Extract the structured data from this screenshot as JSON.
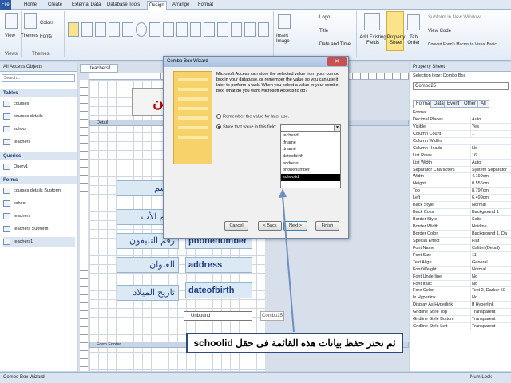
{
  "ribbon_tabs": [
    "File",
    "Home",
    "Create",
    "External Data",
    "Database Tools",
    "Design",
    "Arrange",
    "Format"
  ],
  "ribbon": {
    "view_label": "View",
    "themes_label": "Themes",
    "colors_label": "Colors",
    "fonts_label": "Fonts",
    "logo_label": "Logo",
    "title_label": "Title",
    "date_time_label": "Date and Time",
    "insert_image_label": "Insert Image",
    "add_fields_label": "Add Existing Fields",
    "property_sheet_label": "Property Sheet",
    "tab_order_label": "Tab Order",
    "subform_label": "Subform in New Window",
    "view_code_label": "View Code",
    "convert_macros_label": "Convert Form's Macros to Visual Basic",
    "group_views": "Views",
    "group_themes": "Themes"
  },
  "nav": {
    "header": "All Access Objects",
    "search_placeholder": "Search...",
    "tables_header": "Tables",
    "tables": [
      "courses",
      "courses details",
      "school",
      "teachers"
    ],
    "queries_header": "Queries",
    "queries": [
      "Query1"
    ],
    "forms_header": "Forms",
    "forms": [
      "courses details Subform",
      "school",
      "teachers",
      "teachers Subform",
      "teachers1"
    ]
  },
  "document": {
    "tab_label": "teachers1",
    "form_title": "مين",
    "detail_label": "Detail",
    "footer_label": "Form Footer",
    "labels": [
      "الاسم",
      "اسم الأب",
      "رقم التليفون",
      "العنوان",
      "تاريخ الميلاد"
    ],
    "fields": [
      "",
      "",
      "phonenumber",
      "address",
      "dateofbirth"
    ],
    "unbound_label": "Unbound",
    "combo_label": "Combo25"
  },
  "dialog": {
    "title": "Combo Box Wizard",
    "description": "Microsoft Access can store the selected value from your combo box in your database, or remember the value so you can use it later to perform a task. When you select a value in your combo box, what do you want Microsoft Access to do?",
    "option_remember": "Remember the value for later use.",
    "option_store": "Store that value in this field:",
    "combo_value": "",
    "dropdown_items": [
      "techerid",
      "tfname",
      "ttname",
      "dateofbirth",
      "address",
      "phonenumber",
      "schoolid"
    ],
    "selected_item": "schoolid",
    "buttons": {
      "cancel": "Cancel",
      "back": "< Back",
      "next": "Next >",
      "finish": "Finish"
    }
  },
  "caption_text": "ثم نختر حفظ بيانات هذه القائمة فى حقل schoolid",
  "props": {
    "header": "Property Sheet",
    "selection_type": "Selection type:  Combo Box",
    "selected": "Combo25",
    "tabs": [
      "Format",
      "Data",
      "Event",
      "Other",
      "All"
    ],
    "rows": [
      [
        "Format",
        ""
      ],
      [
        "Decimal Places",
        "Auto"
      ],
      [
        "Visible",
        "Yes"
      ],
      [
        "Column Count",
        "1"
      ],
      [
        "Column Widths",
        ""
      ],
      [
        "Column Heads",
        "No"
      ],
      [
        "List Rows",
        "16"
      ],
      [
        "List Width",
        "Auto"
      ],
      [
        "Separator Characters",
        "System Separator"
      ],
      [
        "Width",
        "4.199cm"
      ],
      [
        "Height",
        "0.556cm"
      ],
      [
        "Top",
        "8.797cm"
      ],
      [
        "Left",
        "6.499cm"
      ],
      [
        "Back Style",
        "Normal"
      ],
      [
        "Back Color",
        "Background 1"
      ],
      [
        "Border Style",
        "Solid"
      ],
      [
        "Border Width",
        "Hairline"
      ],
      [
        "Border Color",
        "Background 1, Da"
      ],
      [
        "Special Effect",
        "Flat"
      ],
      [
        "Font Name",
        "Calibri (Detail)"
      ],
      [
        "Font Size",
        "11"
      ],
      [
        "Text Align",
        "General"
      ],
      [
        "Font Weight",
        "Normal"
      ],
      [
        "Font Underline",
        "No"
      ],
      [
        "Font Italic",
        "No"
      ],
      [
        "Fore Color",
        "Text 2, Darker 50"
      ],
      [
        "Is Hyperlink",
        "No"
      ],
      [
        "Display As Hyperlink",
        "If Hyperlink"
      ],
      [
        "Gridline Style Top",
        "Transparent"
      ],
      [
        "Gridline Style Bottom",
        "Transparent"
      ],
      [
        "Gridline Style Left",
        "Transparent"
      ]
    ]
  },
  "status": {
    "left": "Combo Box Wizard",
    "right": "Num Lock"
  }
}
